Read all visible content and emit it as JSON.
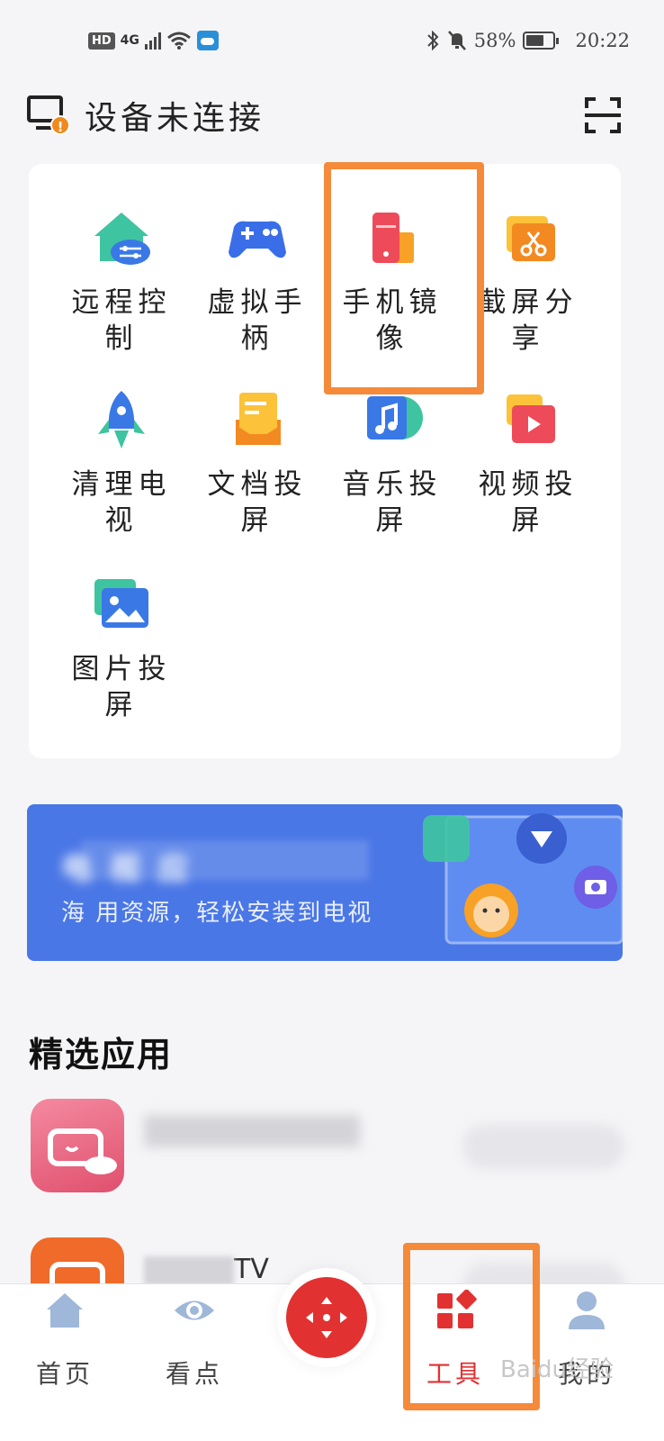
{
  "status_bar": {
    "left_badges": [
      "HD",
      "4G"
    ],
    "battery": "58%",
    "time": "20:22"
  },
  "header": {
    "title": "设备未连接"
  },
  "tools": [
    {
      "label": "远程控制",
      "icon": "remote-control-home-icon"
    },
    {
      "label": "虚拟手柄",
      "icon": "gamepad-icon"
    },
    {
      "label": "手机镜像",
      "icon": "phone-mirror-icon"
    },
    {
      "label": "截屏分享",
      "icon": "screenshot-scissors-icon"
    },
    {
      "label": "清理电视",
      "icon": "rocket-icon"
    },
    {
      "label": "文档投屏",
      "icon": "document-envelope-icon"
    },
    {
      "label": "音乐投屏",
      "icon": "music-note-icon"
    },
    {
      "label": "视频投屏",
      "icon": "video-play-icon"
    },
    {
      "label": "图片投屏",
      "icon": "picture-icon"
    }
  ],
  "banner": {
    "line1": "电 视 应",
    "line2": "海 用资源，轻松安装到电视"
  },
  "featured": {
    "title": "精选应用",
    "apps": [
      {
        "name": "",
        "action": ""
      },
      {
        "name": "TV",
        "action": ""
      }
    ]
  },
  "bottom_nav": {
    "items": [
      {
        "label": "首页",
        "active": false
      },
      {
        "label": "看点",
        "active": false
      },
      {
        "label": "工具",
        "active": true
      },
      {
        "label": "我的",
        "active": false
      }
    ]
  },
  "watermark": "Baidu经验",
  "colors": {
    "highlight": "#f58a3a",
    "accent_red": "#e23131",
    "banner_blue": "#4a77e6"
  }
}
